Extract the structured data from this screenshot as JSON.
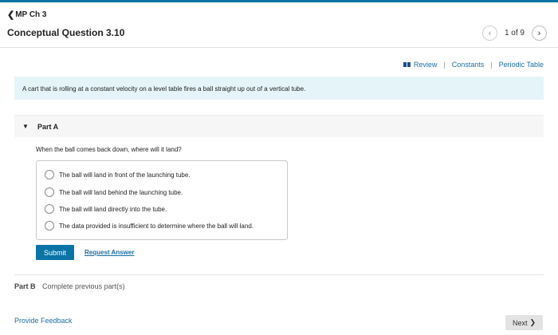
{
  "header": {
    "back_label": "MP Ch 3",
    "title": "Conceptual Question 3.10",
    "pager": {
      "text": "1 of 9"
    }
  },
  "resources": {
    "review": "Review",
    "separator": "|",
    "constants": "Constants",
    "periodic_table": "Periodic Table"
  },
  "problem_statement": "A cart that is rolling at a constant velocity on a level table fires a ball straight up out of a vertical tube.",
  "part_a": {
    "label": "Part A",
    "question": "When the ball comes back down, where will it land?",
    "options": [
      "The ball will land in front of the launching tube.",
      "The ball will land behind the launching tube.",
      "The ball will land directly into the tube.",
      "The data provided is insufficient to determine where the ball will land."
    ],
    "submit_label": "Submit",
    "request_answer_label": "Request Answer"
  },
  "part_b": {
    "label": "Part B",
    "status": "Complete previous part(s)"
  },
  "footer": {
    "feedback_label": "Provide Feedback",
    "next_label": "Next"
  },
  "colors": {
    "accent": "#0b74a6",
    "link": "#1a6fa5",
    "statement_bg": "#e5f4f8"
  },
  "icons": [
    "chevron-left-icon",
    "chevron-right-icon",
    "review-icon",
    "caret-down-icon"
  ]
}
